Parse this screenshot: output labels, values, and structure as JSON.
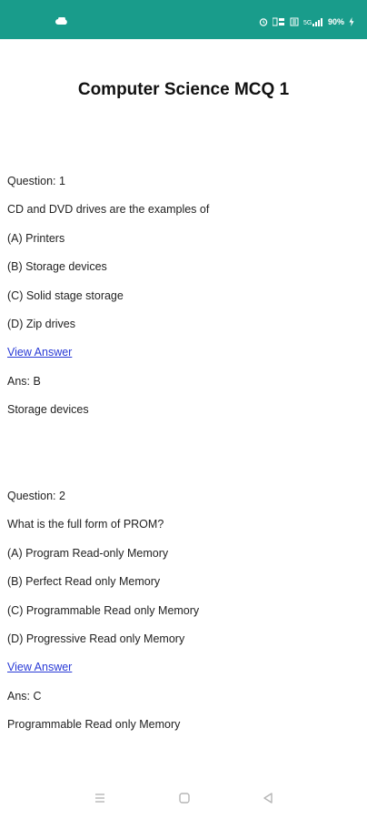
{
  "status_bar": {
    "battery": "90%",
    "icons": [
      "cloud-icon",
      "alarm-icon",
      "data-speed-icon",
      "sim-icon",
      "signal-icon",
      "battery-charging-icon"
    ]
  },
  "page": {
    "title": "Computer Science MCQ 1"
  },
  "questions": [
    {
      "number_label": "Question: 1",
      "text": "CD and DVD drives are the examples of",
      "options": [
        "(A) Printers",
        "(B) Storage devices",
        "(C) Solid stage storage",
        "(D) Zip drives"
      ],
      "view_answer_label": "View Answer",
      "answer_label": "Ans: B",
      "answer_text": "Storage devices"
    },
    {
      "number_label": "Question: 2",
      "text": "What is the full form of PROM?",
      "options": [
        "(A) Program Read-only Memory",
        "(B) Perfect Read only Memory",
        "(C) Programmable Read only Memory",
        "(D) Progressive Read only Memory"
      ],
      "view_answer_label": "View Answer",
      "answer_label": "Ans: C",
      "answer_text": "Programmable Read only Memory"
    }
  ],
  "nav_bar": {
    "icons": [
      "menu-icon",
      "home-square-icon",
      "back-triangle-icon"
    ]
  },
  "colors": {
    "status_bar": "#199c8b",
    "link": "#2a3bd6"
  }
}
